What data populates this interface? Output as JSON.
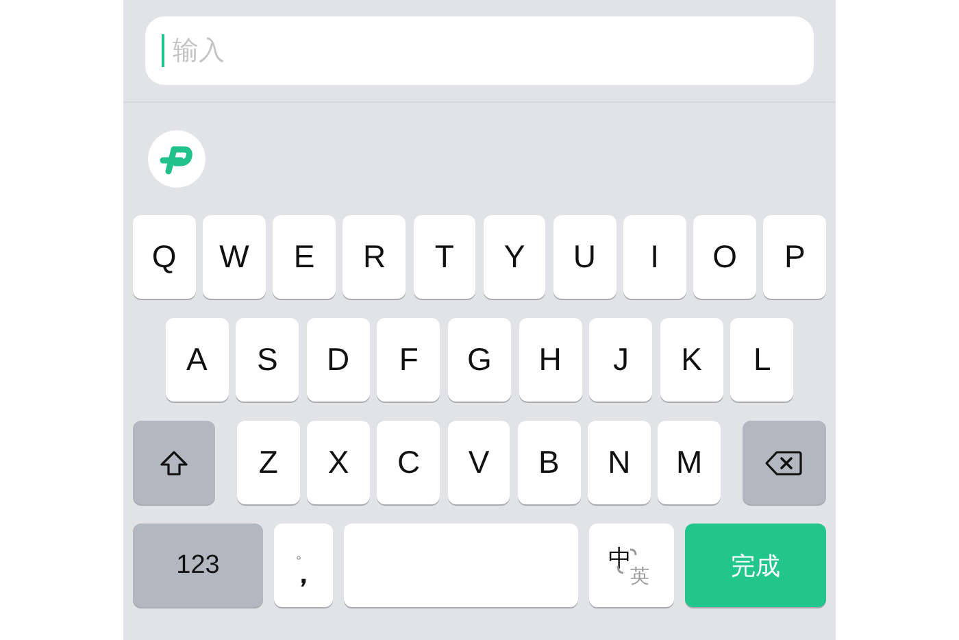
{
  "input": {
    "placeholder": "输入",
    "focused": true
  },
  "rows": [
    {
      "keys": [
        {
          "kind": "letter",
          "label": "Q"
        },
        {
          "kind": "letter",
          "label": "W"
        },
        {
          "kind": "letter",
          "label": "E"
        },
        {
          "kind": "letter",
          "label": "R"
        },
        {
          "kind": "letter",
          "label": "T"
        },
        {
          "kind": "letter",
          "label": "Y"
        },
        {
          "kind": "letter",
          "label": "U"
        },
        {
          "kind": "letter",
          "label": "I"
        },
        {
          "kind": "letter",
          "label": "O"
        },
        {
          "kind": "letter",
          "label": "P"
        }
      ]
    },
    {
      "keys": [
        {
          "kind": "letter",
          "label": "A"
        },
        {
          "kind": "letter",
          "label": "S"
        },
        {
          "kind": "letter",
          "label": "D"
        },
        {
          "kind": "letter",
          "label": "F"
        },
        {
          "kind": "letter",
          "label": "G"
        },
        {
          "kind": "letter",
          "label": "H"
        },
        {
          "kind": "letter",
          "label": "J"
        },
        {
          "kind": "letter",
          "label": "K"
        },
        {
          "kind": "letter",
          "label": "L"
        }
      ]
    },
    {
      "keys": [
        {
          "kind": "shift"
        },
        {
          "kind": "letter",
          "label": "Z"
        },
        {
          "kind": "letter",
          "label": "X"
        },
        {
          "kind": "letter",
          "label": "C"
        },
        {
          "kind": "letter",
          "label": "V"
        },
        {
          "kind": "letter",
          "label": "B"
        },
        {
          "kind": "letter",
          "label": "N"
        },
        {
          "kind": "letter",
          "label": "M"
        },
        {
          "kind": "delete"
        }
      ]
    },
    {
      "keys": [
        {
          "kind": "numbers",
          "label": "123"
        },
        {
          "kind": "punct",
          "top": "。",
          "bottom": "，"
        },
        {
          "kind": "space"
        },
        {
          "kind": "lang",
          "main": "中",
          "alt": "英"
        },
        {
          "kind": "done",
          "label": "完成"
        }
      ]
    }
  ]
}
